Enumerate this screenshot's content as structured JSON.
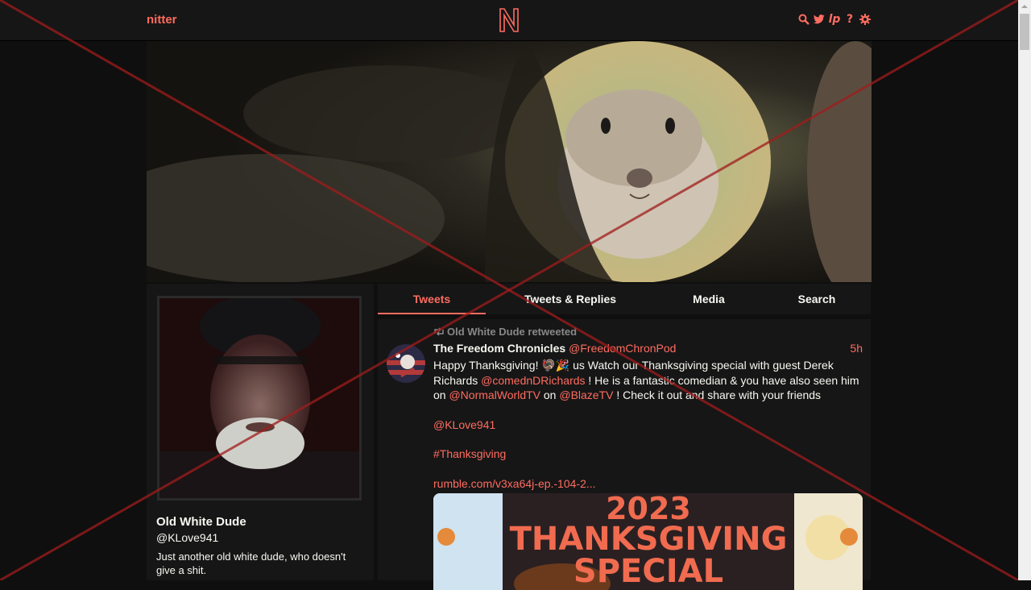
{
  "navbar": {
    "brand": "nitter",
    "logo_letter": "N",
    "icons": [
      "search-icon",
      "twitter-bird-icon",
      "liberapay-icon",
      "help-icon",
      "settings-gear-icon"
    ],
    "help_glyph": "?",
    "liberapay_glyph": "lp"
  },
  "profile": {
    "fullname": "Old White Dude",
    "username": "@KLove941",
    "bio": "Just another old white dude, who doesn't give a shit."
  },
  "tabs": [
    {
      "label": "Tweets",
      "active": true
    },
    {
      "label": "Tweets & Replies",
      "active": false
    },
    {
      "label": "Media",
      "active": false
    },
    {
      "label": "Search",
      "active": false
    }
  ],
  "tweet": {
    "retweet_header": "Old White Dude retweeted",
    "fullname": "The Freedom Chronicles",
    "username": "@FreedomChronPod",
    "date": "5h",
    "line1_prefix": "Happy Thanksgiving! 🦃🎉 us Watch our Thanksgiving special with guest Derek Richards ",
    "mention1": "@comednDRichards",
    "line1_mid": " ! He is a fantastic comedian & you have also seen him on ",
    "mention2": "@NormalWorldTV",
    "line1_on": " on ",
    "mention3": "@BlazeTV",
    "line1_end": " ! Check it out and share with your friends",
    "mention4": "@KLove941",
    "hashtag": "#Thanksgiving",
    "link": "rumble.com/v3xa64j-ep.-104-2...",
    "card_text": {
      "year": "2023",
      "title_line1": "THANKSGIVING",
      "title_line2": "SPECIAL"
    }
  },
  "colors": {
    "accent": "#ff6c60",
    "bg": "#0f0f0f",
    "panel": "#161616",
    "fg": "#f8f8f2",
    "muted": "#888889"
  }
}
